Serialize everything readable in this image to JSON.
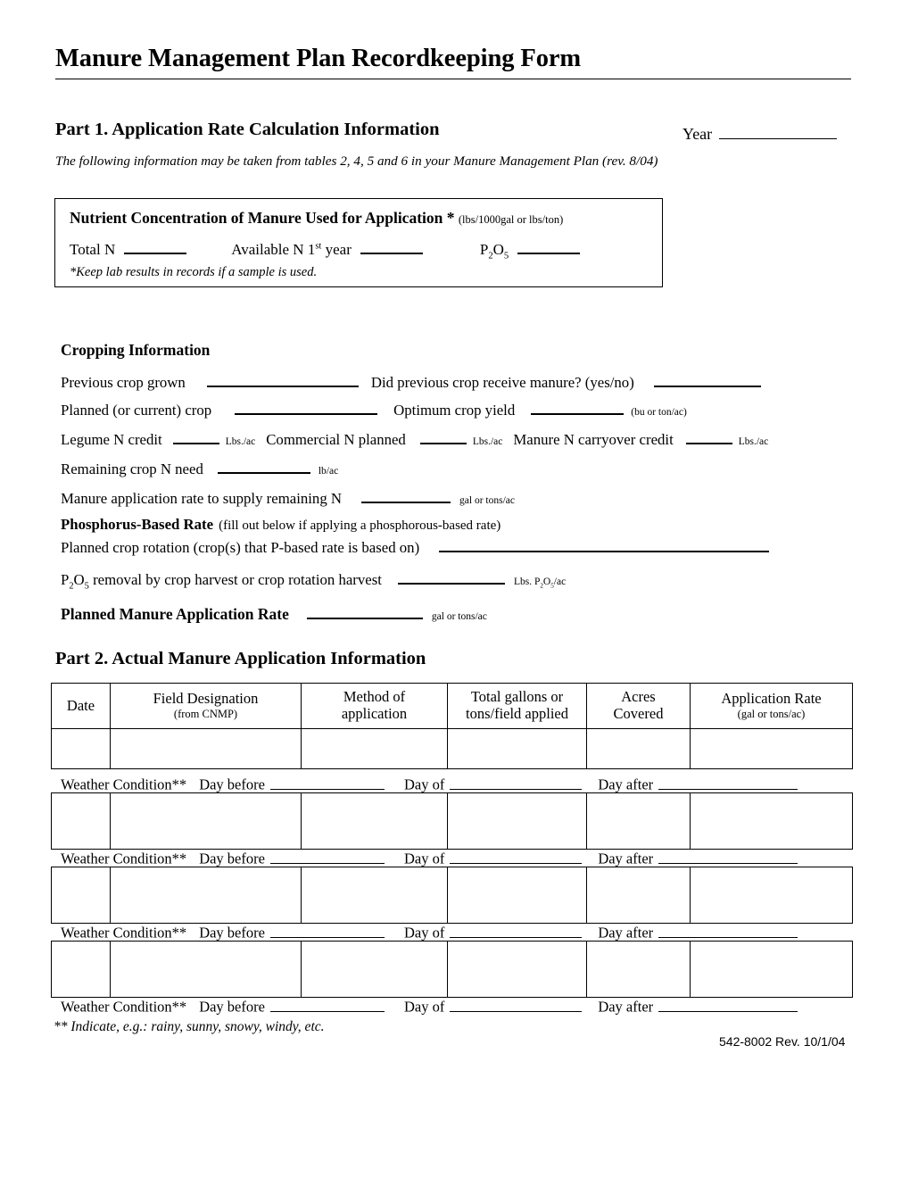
{
  "document": {
    "title": "Manure Management Plan Recordkeeping Form",
    "form_code": "542-8002 Rev. 10/1/04"
  },
  "part1": {
    "heading": "Part 1. Application Rate Calculation Information",
    "year_label": "Year",
    "year_value": "",
    "subtitle": "The following information may be taken from tables 2, 4, 5 and 6 in your Manure Management Plan (rev. 8/04)"
  },
  "nutrient_box": {
    "title": "Nutrient Concentration of Manure Used for Application *",
    "units": "(lbs/1000gal or lbs/ton)",
    "total_n_label": "Total N",
    "total_n_value": "",
    "available_n_label_a": "Available N 1",
    "available_n_sup": "st",
    "available_n_label_b": " year",
    "available_n_value": "",
    "p2o5_label_p": "P",
    "p2o5_sub1": "2",
    "p2o5_label_o": "O",
    "p2o5_sub2": "5",
    "p2o5_value": "",
    "note": "*Keep lab results in records if a sample is used."
  },
  "cropping": {
    "heading": "Cropping Information",
    "previous_crop_label": "Previous crop grown",
    "previous_crop_value": "",
    "previous_manure_label": "Did previous crop receive manure? (yes/no)",
    "previous_manure_value": "",
    "planned_crop_label": "Planned (or current) crop",
    "planned_crop_value": "",
    "optimum_yield_label": "Optimum crop yield",
    "optimum_yield_value": "",
    "optimum_yield_units": "(bu or  ton/ac)",
    "legume_label": "Legume N credit",
    "legume_value": "",
    "legume_units": "Lbs./ac",
    "commercial_label": "Commercial N planned",
    "commercial_value": "",
    "commercial_units": "Lbs./ac",
    "carryover_label": "Manure N carryover credit",
    "carryover_value": "",
    "carryover_units": "Lbs./ac",
    "remaining_label": "Remaining crop N need",
    "remaining_value": "",
    "remaining_units": "lb/ac",
    "app_rate_label": "Manure application rate to supply remaining N",
    "app_rate_value": "",
    "app_rate_units": "gal or  tons/ac"
  },
  "phosphorus": {
    "heading": "Phosphorus-Based Rate",
    "heading_note": "(fill out below if applying a phosphorous-based rate)",
    "rotation_label": "Planned crop rotation (crop(s) that P-based rate is based on)",
    "rotation_value": "",
    "removal_label_pre": "P",
    "removal_sub1": "2",
    "removal_label_o": "O",
    "removal_sub2": "5",
    "removal_label_rest": " removal by crop harvest or crop rotation harvest",
    "removal_value": "",
    "removal_units_pre": "Lbs. P",
    "removal_units_sub1": "2",
    "removal_units_o": "O",
    "removal_units_sub2": "5",
    "removal_units_post": "/ac"
  },
  "planned_rate": {
    "label": "Planned Manure Application Rate",
    "value": "",
    "units": "gal or  tons/ac"
  },
  "part2": {
    "heading": "Part 2. Actual Manure Application Information",
    "columns": [
      {
        "title": "Date",
        "sub": ""
      },
      {
        "title": "Field Designation",
        "sub": "(from CNMP)"
      },
      {
        "title": "Method of",
        "sub": "application",
        "two_line": true
      },
      {
        "title": "Total gallons or",
        "sub": "tons/field applied",
        "two_line": true
      },
      {
        "title": "Acres",
        "sub": "Covered",
        "two_line": true
      },
      {
        "title": "Application Rate",
        "sub": "(gal or tons/ac)"
      }
    ],
    "rows": [
      {
        "date": "",
        "field_designation": "",
        "method": "",
        "total": "",
        "acres": "",
        "rate": ""
      },
      {
        "date": "",
        "field_designation": "",
        "method": "",
        "total": "",
        "acres": "",
        "rate": ""
      },
      {
        "date": "",
        "field_designation": "",
        "method": "",
        "total": "",
        "acres": "",
        "rate": ""
      },
      {
        "date": "",
        "field_designation": "",
        "method": "",
        "total": "",
        "acres": "",
        "rate": ""
      }
    ],
    "weather": {
      "label": "Weather Condition**",
      "day_before_label": "Day before",
      "day_before_value": "",
      "day_of_label": "Day of",
      "day_of_value": "",
      "day_after_label": "Day after",
      "day_after_value": ""
    },
    "footnote": "** Indicate, e.g.: rainy, sunny, snowy, windy, etc."
  }
}
